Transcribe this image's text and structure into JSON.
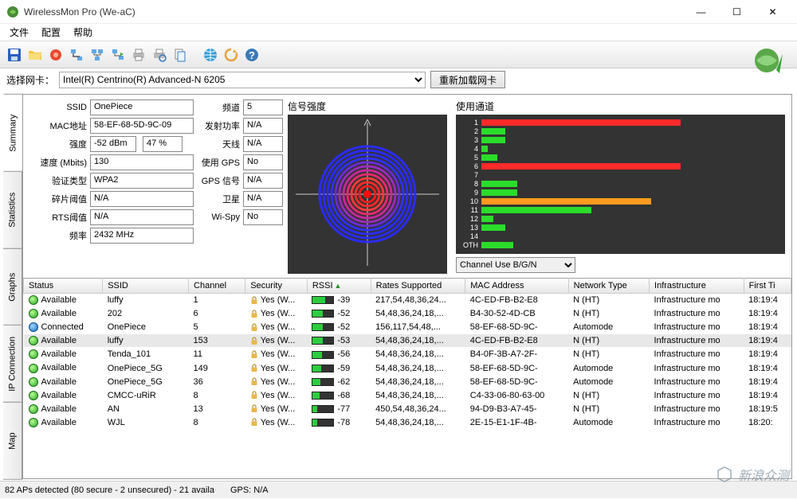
{
  "window": {
    "title": "WirelessMon Pro (We-aC)",
    "min": "—",
    "max": "☐",
    "close": "✕"
  },
  "menu": {
    "file": "文件",
    "config": "配置",
    "help": "帮助"
  },
  "selector": {
    "label": "选择网卡：",
    "value": "Intel(R) Centrino(R) Advanced-N 6205",
    "reload_btn": "重新加载网卡"
  },
  "side_tabs": [
    "Summary",
    "Statistics",
    "Graphs",
    "IP Connection",
    "Map"
  ],
  "info": {
    "c1": {
      "ssid_lbl": "SSID",
      "ssid": "OnePiece",
      "mac_lbl": "MAC地址",
      "mac": "58-EF-68-5D-9C-09",
      "strength_lbl": "强度",
      "strength_dbm": "-52 dBm",
      "strength_pct": "47 %",
      "speed_lbl": "速度 (Mbits)",
      "speed": "130",
      "auth_lbl": "验证类型",
      "auth": "WPA2",
      "frag_lbl": "碎片阈值",
      "frag": "N/A",
      "rts_lbl": "RTS阈值",
      "rts": "N/A",
      "freq_lbl": "频率",
      "freq": "2432 MHz"
    },
    "c2": {
      "channel_lbl": "频道",
      "channel": "5",
      "txpower_lbl": "发射功率",
      "txpower": "N/A",
      "antenna_lbl": "天线",
      "antenna": "N/A",
      "use_gps_lbl": "使用 GPS",
      "use_gps": "No",
      "gps_sig_lbl": "GPS 信号",
      "gps_sig": "N/A",
      "sat_lbl": "卫星",
      "sat": "N/A",
      "wispy_lbl": "Wi-Spy",
      "wispy": "No"
    }
  },
  "signal_title": "信号强度",
  "channel_title": "使用通道",
  "channel_select": "Channel Use B/G/N",
  "chart_data": {
    "type": "bar",
    "title": "使用通道",
    "xlabel": "",
    "ylabel": "",
    "categories": [
      "1",
      "2",
      "3",
      "4",
      "5",
      "6",
      "7",
      "8",
      "9",
      "10",
      "11",
      "12",
      "13",
      "14",
      "OTH"
    ],
    "series": [
      {
        "name": "usage",
        "values": [
          100,
          12,
          12,
          3,
          8,
          100,
          0,
          18,
          18,
          85,
          55,
          6,
          12,
          0,
          16
        ],
        "colors": [
          "#ff2a2a",
          "#2bdc2b",
          "#2bdc2b",
          "#2bdc2b",
          "#2bdc2b",
          "#ff2a2a",
          "#2bdc2b",
          "#2bdc2b",
          "#2bdc2b",
          "#ff9a1f",
          "#2bdc2b",
          "#2bdc2b",
          "#2bdc2b",
          "#2bdc2b",
          "#2bdc2b"
        ]
      }
    ],
    "ylim": [
      0,
      100
    ]
  },
  "table": {
    "cols": [
      "Status",
      "SSID",
      "Channel",
      "Security",
      "RSSI",
      "Rates Supported",
      "MAC Address",
      "Network Type",
      "Infrastructure",
      "First Ti"
    ],
    "rows": [
      {
        "led": "green",
        "status": "Available",
        "ssid": "luffy",
        "channel": "1",
        "sec": "Yes (W...",
        "rssi": -39,
        "rssi_pct": 62,
        "rates": "217,54,48,36,24...",
        "mac": "4C-ED-FB-B2-E8",
        "nt": "N (HT)",
        "inf": "Infrastructure mo",
        "ft": "18:19:4"
      },
      {
        "led": "green",
        "status": "Available",
        "ssid": "202",
        "channel": "6",
        "sec": "Yes (W...",
        "rssi": -52,
        "rssi_pct": 48,
        "rates": "54,48,36,24,18,...",
        "mac": "B4-30-52-4D-CB",
        "nt": "N (HT)",
        "inf": "Infrastructure mo",
        "ft": "18:19:4"
      },
      {
        "led": "blue",
        "status": "Connected",
        "ssid": "OnePiece",
        "channel": "5",
        "sec": "Yes (W...",
        "rssi": -52,
        "rssi_pct": 48,
        "rates": "156,117,54,48,...",
        "mac": "58-EF-68-5D-9C-",
        "nt": "Automode",
        "inf": "Infrastructure mo",
        "ft": "18:19:4"
      },
      {
        "led": "green",
        "status": "Available",
        "ssid": "luffy",
        "channel": "153",
        "sec": "Yes (W...",
        "rssi": -53,
        "rssi_pct": 47,
        "rates": "54,48,36,24,18,...",
        "mac": "4C-ED-FB-B2-E8",
        "nt": "N (HT)",
        "inf": "Infrastructure mo",
        "ft": "18:19:4",
        "sel": true
      },
      {
        "led": "green",
        "status": "Available",
        "ssid": "Tenda_101",
        "channel": "11",
        "sec": "Yes (W...",
        "rssi": -56,
        "rssi_pct": 44,
        "rates": "54,48,36,24,18,...",
        "mac": "B4-0F-3B-A7-2F-",
        "nt": "N (HT)",
        "inf": "Infrastructure mo",
        "ft": "18:19:4"
      },
      {
        "led": "green",
        "status": "Available",
        "ssid": "OnePiece_5G",
        "channel": "149",
        "sec": "Yes (W...",
        "rssi": -59,
        "rssi_pct": 41,
        "rates": "54,48,36,24,18,...",
        "mac": "58-EF-68-5D-9C-",
        "nt": "Automode",
        "inf": "Infrastructure mo",
        "ft": "18:19:4"
      },
      {
        "led": "green",
        "status": "Available",
        "ssid": "OnePiece_5G",
        "channel": "36",
        "sec": "Yes (W...",
        "rssi": -62,
        "rssi_pct": 38,
        "rates": "54,48,36,24,18,...",
        "mac": "58-EF-68-5D-9C-",
        "nt": "Automode",
        "inf": "Infrastructure mo",
        "ft": "18:19:4"
      },
      {
        "led": "green",
        "status": "Available",
        "ssid": "CMCC-uRiR",
        "channel": "8",
        "sec": "Yes (W...",
        "rssi": -68,
        "rssi_pct": 32,
        "rates": "54,48,36,24,18,...",
        "mac": "C4-33-06-80-63-00",
        "nt": "N (HT)",
        "inf": "Infrastructure mo",
        "ft": "18:19:4"
      },
      {
        "led": "green",
        "status": "Available",
        "ssid": "AN",
        "channel": "13",
        "sec": "Yes (W...",
        "rssi": -77,
        "rssi_pct": 23,
        "rates": "450,54,48,36,24...",
        "mac": "94-D9-B3-A7-45-",
        "nt": "N (HT)",
        "inf": "Infrastructure mo",
        "ft": "18:19:5"
      },
      {
        "led": "green",
        "status": "Available",
        "ssid": "WJL",
        "channel": "8",
        "sec": "Yes (W...",
        "rssi": -78,
        "rssi_pct": 22,
        "rates": "54,48,36,24,18,...",
        "mac": "2E-15-E1-1F-4B-",
        "nt": "Automode",
        "inf": "Infrastructure mo",
        "ft": "18:20:"
      }
    ]
  },
  "statusbar": {
    "aps": "82 APs detected (80 secure - 2 unsecured) - 21 availa",
    "gps": "GPS: N/A"
  },
  "watermark": "新浪众测"
}
